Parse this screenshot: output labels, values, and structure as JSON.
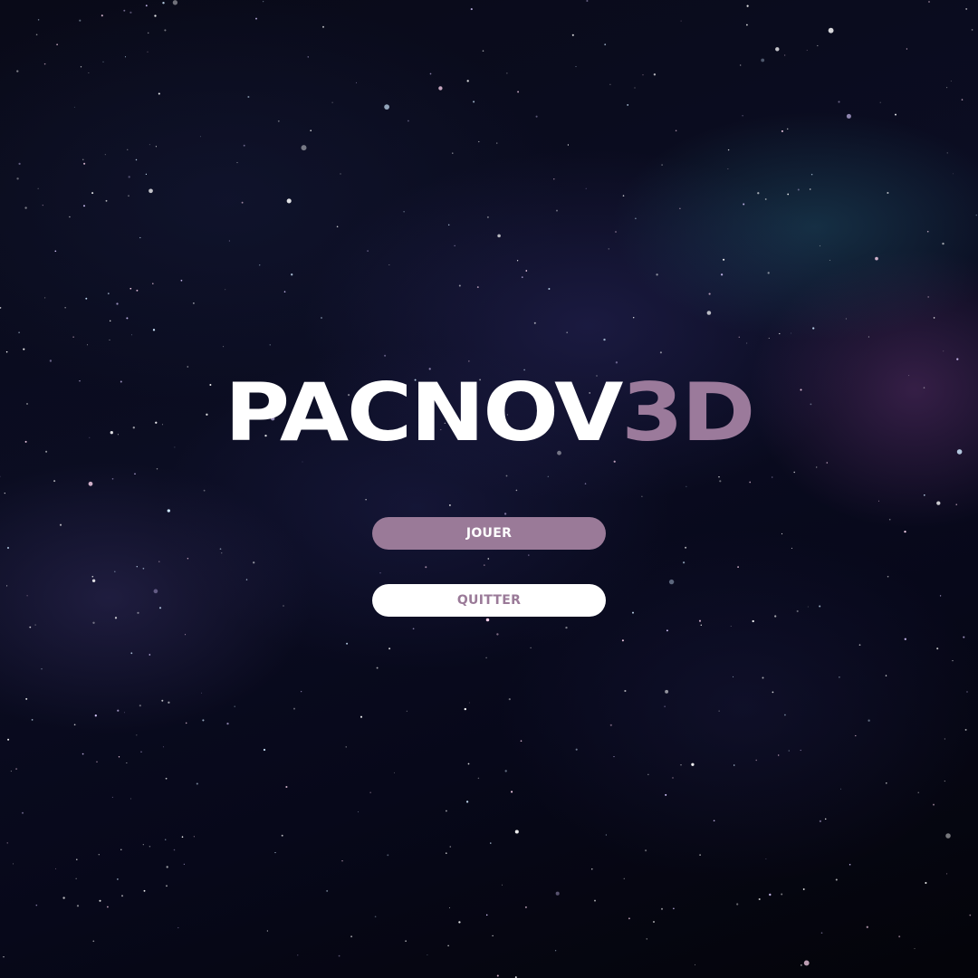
{
  "title": {
    "main": "PACNOV",
    "accent": "3D"
  },
  "menu": {
    "play_label": "JOUER",
    "quit_label": "QUITTER"
  },
  "colors": {
    "accent": "#9a7a98",
    "title_text": "#ffffff",
    "background": "#0a0b1c"
  }
}
